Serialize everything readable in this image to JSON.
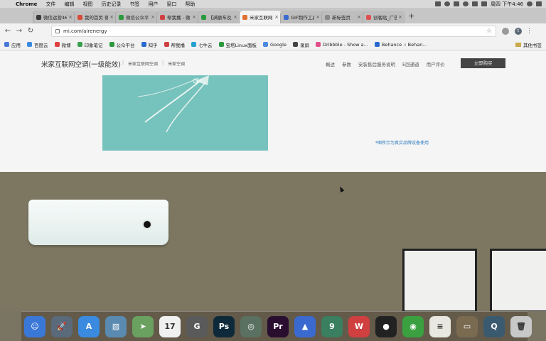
{
  "menubar": {
    "app": "Chrome",
    "items": [
      "文件",
      "编辑",
      "视图",
      "历史记录",
      "书签",
      "用户",
      "窗口",
      "帮助"
    ],
    "clock": "周四 下午4:46"
  },
  "tabs": [
    {
      "title": "微信运营46",
      "color": "#3a3a3a",
      "active": false
    },
    {
      "title": "我的首页 微",
      "color": "#d84a3a",
      "active": false
    },
    {
      "title": "微信公众平台",
      "color": "#2b9a3e",
      "active": false
    },
    {
      "title": "帮我播 - 微",
      "color": "#d04040",
      "active": false
    },
    {
      "title": "【满额车及所",
      "color": "#2b9a3e",
      "active": false
    },
    {
      "title": "米家互联网空",
      "color": "#e07030",
      "active": true
    },
    {
      "title": "GIF制作工具",
      "color": "#3a6ad0",
      "active": false
    },
    {
      "title": "新标签页",
      "color": "#888888",
      "active": false
    },
    {
      "title": "创客贴_广告",
      "color": "#e05050",
      "active": false
    }
  ],
  "address": {
    "url": "mi.com/airenergy",
    "avatar": "t"
  },
  "bookmarks": [
    {
      "label": "应用",
      "color": "#4a7ad8"
    },
    {
      "label": "百度云",
      "color": "#3a8ae0"
    },
    {
      "label": "微博",
      "color": "#e04040"
    },
    {
      "label": "印象笔记",
      "color": "#3aa050"
    },
    {
      "label": "公众平台",
      "color": "#2b9a3e"
    },
    {
      "label": "知乎",
      "color": "#2a6ad0"
    },
    {
      "label": "帮我播",
      "color": "#d04040"
    },
    {
      "label": "七牛云",
      "color": "#2aa0d0"
    },
    {
      "label": "宝塔Linux面板",
      "color": "#2b9a3e"
    },
    {
      "label": "Google",
      "color": "#4a8ae0"
    },
    {
      "label": "录屏",
      "color": "#444444"
    },
    {
      "label": "Dribbble - Show a...",
      "color": "#e0508a"
    },
    {
      "label": "Behance :: Behan...",
      "color": "#2a6ad0"
    }
  ],
  "bookmarks_other": "其他书签",
  "page": {
    "title": "米家互联网空调(一级能效)",
    "sublinks": [
      "米家互联网空调",
      "米家空调"
    ],
    "menu": [
      "概述",
      "参数",
      "安装售后服务说明",
      "E回通道",
      "用户评价"
    ],
    "buy_label": "立即购买",
    "caption": "*图所示为真实品牌设备使用"
  },
  "dock": [
    {
      "name": "finder",
      "color": "#3a78d8",
      "glyph": "☺"
    },
    {
      "name": "launchpad",
      "color": "#5a6a7a",
      "glyph": "🚀"
    },
    {
      "name": "app-store",
      "color": "#3a8ae0",
      "glyph": "A"
    },
    {
      "name": "preview",
      "color": "#5a8ab0",
      "glyph": "▨"
    },
    {
      "name": "maps",
      "color": "#6aa060",
      "glyph": "➤"
    },
    {
      "name": "calendar",
      "color": "#f0f0f0",
      "glyph": "17"
    },
    {
      "name": "gif-tool",
      "color": "#5a5a5a",
      "glyph": "G"
    },
    {
      "name": "photoshop",
      "color": "#0e2a3a",
      "glyph": "Ps"
    },
    {
      "name": "chrome",
      "color": "#5a7060",
      "glyph": "◎"
    },
    {
      "name": "premiere",
      "color": "#2a0e30",
      "glyph": "Pr"
    },
    {
      "name": "keynote",
      "color": "#3a6ad0",
      "glyph": "▲"
    },
    {
      "name": "app-nine",
      "color": "#3a8060",
      "glyph": "9"
    },
    {
      "name": "wps",
      "color": "#d04040",
      "glyph": "W"
    },
    {
      "name": "qq",
      "color": "#222222",
      "glyph": "●"
    },
    {
      "name": "wechat",
      "color": "#3aa040",
      "glyph": "◉"
    },
    {
      "name": "notes",
      "color": "#e8e8e0",
      "glyph": "≡"
    },
    {
      "name": "image-capture",
      "color": "#7a6a50",
      "glyph": "▭"
    },
    {
      "name": "quicktime",
      "color": "#3a5a70",
      "glyph": "Q"
    },
    {
      "name": "trash",
      "color": "#c8c8c8",
      "glyph": "🗑"
    }
  ]
}
